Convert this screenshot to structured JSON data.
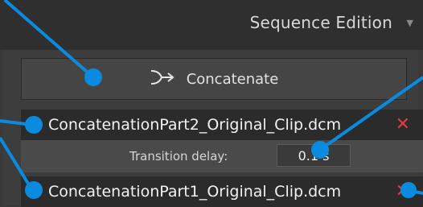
{
  "header": {
    "title": "Sequence Edition",
    "caret_icon": "chevron-down-icon"
  },
  "concatenate": {
    "label": "Concatenate",
    "icon": "merge-arrow-icon"
  },
  "clips": [
    {
      "name": "ConcatenationPart2_Original_Clip.dcm",
      "remove_icon": "close-icon"
    },
    {
      "name": "ConcatenationPart1_Original_Clip.dcm",
      "remove_icon": "close-icon"
    }
  ],
  "transition": {
    "label": "Transition delay:",
    "value": "0.1 s"
  },
  "colors": {
    "accent_blue": "#0a8be0",
    "remove_red": "#e23b3b",
    "background": "#3a3a3a"
  }
}
